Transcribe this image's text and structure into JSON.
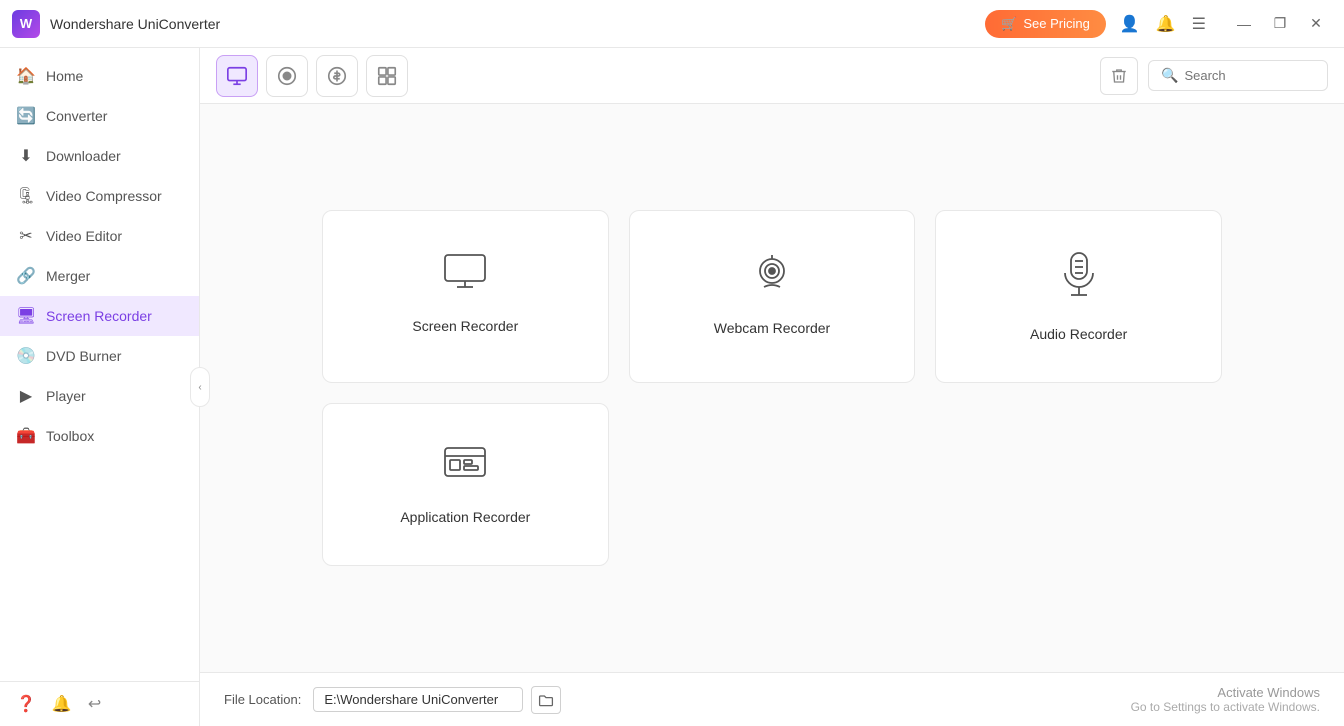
{
  "titleBar": {
    "appName": "Wondershare UniConverter",
    "seePricing": "See Pricing",
    "windowControls": {
      "minimize": "—",
      "maximize": "❐",
      "close": "✕"
    }
  },
  "sidebar": {
    "items": [
      {
        "id": "home",
        "label": "Home",
        "icon": "🏠",
        "active": false
      },
      {
        "id": "converter",
        "label": "Converter",
        "icon": "🔄",
        "active": false
      },
      {
        "id": "downloader",
        "label": "Downloader",
        "icon": "⬇",
        "active": false
      },
      {
        "id": "video-compressor",
        "label": "Video Compressor",
        "icon": "🗜",
        "active": false
      },
      {
        "id": "video-editor",
        "label": "Video Editor",
        "icon": "✂",
        "active": false
      },
      {
        "id": "merger",
        "label": "Merger",
        "icon": "🔗",
        "active": false
      },
      {
        "id": "screen-recorder",
        "label": "Screen Recorder",
        "icon": "🖥",
        "active": true
      },
      {
        "id": "dvd-burner",
        "label": "DVD Burner",
        "icon": "💿",
        "active": false
      },
      {
        "id": "player",
        "label": "Player",
        "icon": "▶",
        "active": false
      },
      {
        "id": "toolbox",
        "label": "Toolbox",
        "icon": "🧰",
        "active": false
      }
    ],
    "bottomIcons": [
      "?",
      "🔔",
      "↩"
    ]
  },
  "toolbar": {
    "tabs": [
      {
        "id": "screen",
        "icon": "screen",
        "active": true
      },
      {
        "id": "record",
        "icon": "record",
        "active": false
      },
      {
        "id": "dollar",
        "icon": "dollar",
        "active": false
      },
      {
        "id": "grid",
        "icon": "grid",
        "active": false
      }
    ],
    "searchPlaceholder": "Search"
  },
  "recorders": {
    "cards": [
      {
        "id": "screen-recorder",
        "label": "Screen Recorder",
        "icon": "screen"
      },
      {
        "id": "webcam-recorder",
        "label": "Webcam Recorder",
        "icon": "webcam"
      },
      {
        "id": "audio-recorder",
        "label": "Audio Recorder",
        "icon": "audio"
      },
      {
        "id": "application-recorder",
        "label": "Application Recorder",
        "icon": "app"
      }
    ]
  },
  "footer": {
    "fileLocationLabel": "File Location:",
    "pathValue": "E:\\Wondershare UniConverter",
    "activateTitle": "Activate Windows",
    "activateDesc": "Go to Settings to activate Windows."
  }
}
